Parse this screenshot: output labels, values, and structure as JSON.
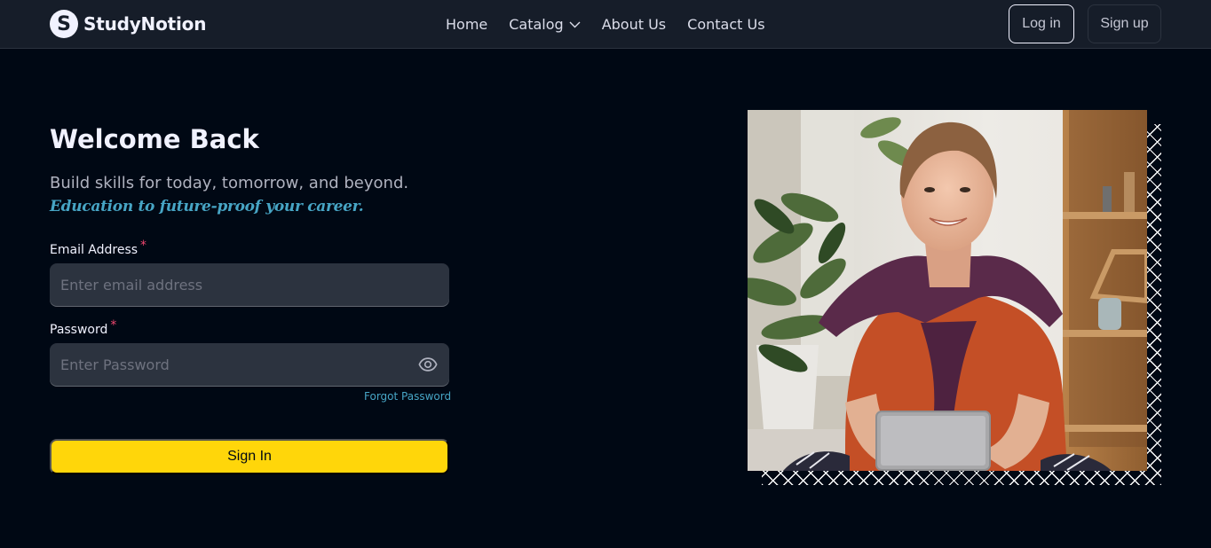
{
  "brand": {
    "name": "StudyNotion",
    "mark": "S"
  },
  "nav": {
    "items": [
      {
        "label": "Home"
      },
      {
        "label": "Catalog"
      },
      {
        "label": "About Us"
      },
      {
        "label": "Contact Us"
      }
    ],
    "login_label": "Log in",
    "signup_label": "Sign up"
  },
  "form": {
    "title": "Welcome Back",
    "subtitle": "Build skills for today, tomorrow, and beyond.",
    "tagline": "Education to future-proof your career.",
    "email_label": "Email Address",
    "email_placeholder": "Enter email address",
    "email_value": "",
    "password_label": "Password",
    "password_placeholder": "Enter Password",
    "password_value": "",
    "required_mark": "*",
    "forgot_label": "Forgot Password",
    "submit_label": "Sign In"
  },
  "icons": {
    "catalog": "chevron-down-icon",
    "password_toggle": "eye-icon"
  },
  "colors": {
    "background": "#000814",
    "navbar": "#161D29",
    "accent_yellow": "#FFD60A",
    "accent_blue": "#47A5C5",
    "required_pink": "#EF476F",
    "input_bg": "#2C333F"
  }
}
